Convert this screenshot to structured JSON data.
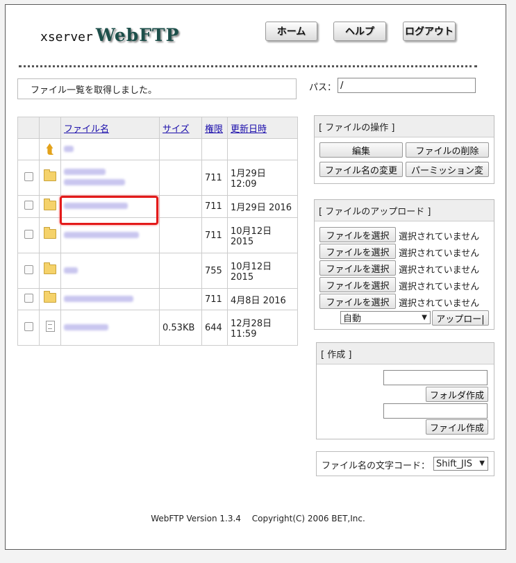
{
  "header": {
    "brand": "xserver",
    "product": "WebFTP",
    "nav": [
      "ホーム",
      "ヘルプ",
      "ログアウト"
    ]
  },
  "status": "ファイル一覧を取得しました。",
  "path": {
    "label": "パス：",
    "value": "/"
  },
  "table": {
    "headers": [
      "ファイル名",
      "サイズ",
      "権限",
      "更新日時"
    ],
    "rows": [
      {
        "type": "folder",
        "size": "",
        "perm": "711",
        "date1": "1月29日",
        "date2": "12:09"
      },
      {
        "type": "folder",
        "size": "",
        "perm": "711",
        "date1": "1月29日 2016",
        "date2": ""
      },
      {
        "type": "folder",
        "size": "",
        "perm": "711",
        "date1": "10月12日",
        "date2": "2015"
      },
      {
        "type": "folder",
        "size": "",
        "perm": "755",
        "date1": "10月12日",
        "date2": "2015"
      },
      {
        "type": "folder",
        "size": "",
        "perm": "711",
        "date1": "4月8日 2016",
        "date2": ""
      },
      {
        "type": "file",
        "size": "0.53KB",
        "perm": "644",
        "date1": "12月28日",
        "date2": "11:59"
      }
    ]
  },
  "file_ops": {
    "title": "[ ファイルの操作 ]",
    "buttons": [
      "編集",
      "ファイルの削除",
      "ファイル名の変更",
      "パーミッション変"
    ]
  },
  "upload": {
    "title": "[ ファイルのアップロード ]",
    "choose_label": "ファイルを選択",
    "none_label": "選択されていません",
    "mode": "自動",
    "upload_btn": "アップロー|"
  },
  "create": {
    "title": "[ 作成 ]",
    "folder_btn": "フォルダ作成",
    "file_btn": "ファイル作成"
  },
  "encoding": {
    "label": "ファイル名の文字コード：",
    "value": "Shift_JIS"
  },
  "footer": "WebFTP Version 1.3.4　 Copyright(C) 2006 BET,Inc.",
  "colors": {
    "link": "#1a0dab",
    "highlight": "#e31a1a",
    "logo": "#1d4f4a"
  },
  "icons": [
    "folder-icon",
    "file-icon",
    "parent-folder-icon",
    "checkbox"
  ]
}
